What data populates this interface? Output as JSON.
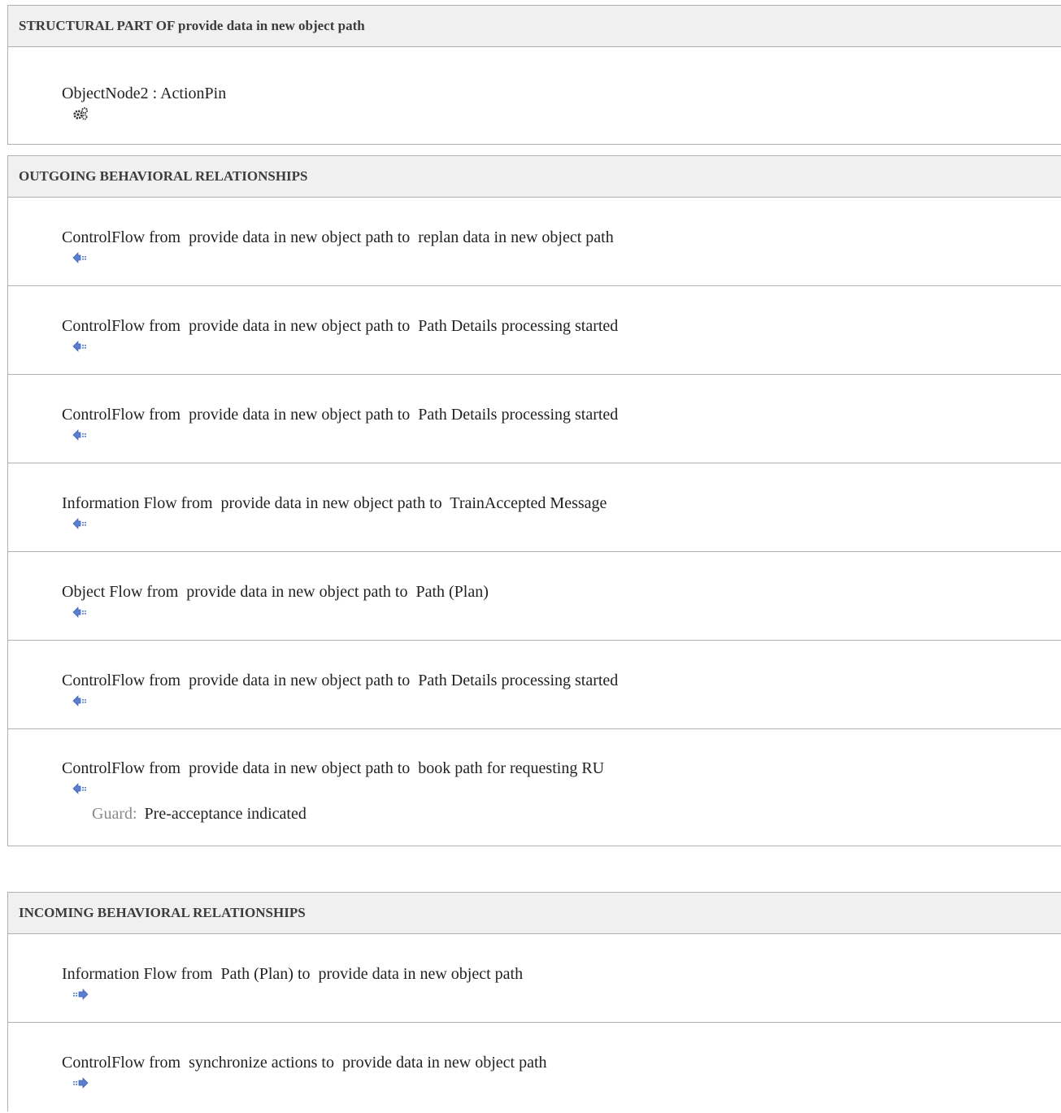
{
  "structural": {
    "header": "STRUCTURAL PART OF provide data in new object path",
    "items": [
      {
        "icon": "gears-icon",
        "text": "ObjectNode2 : ActionPin"
      }
    ]
  },
  "outgoing": {
    "header": "OUTGOING BEHAVIORAL RELATIONSHIPS",
    "items": [
      {
        "icon": "outgoing-arrow-icon",
        "text": "ControlFlow from  provide data in new object path to  replan data in new object path"
      },
      {
        "icon": "outgoing-arrow-icon",
        "text": "ControlFlow from  provide data in new object path to  Path Details processing started"
      },
      {
        "icon": "outgoing-arrow-icon",
        "text": "ControlFlow from  provide data in new object path to  Path Details processing started"
      },
      {
        "icon": "outgoing-arrow-icon",
        "text": "Information Flow from  provide data in new object path to  TrainAccepted Message"
      },
      {
        "icon": "outgoing-arrow-icon",
        "text": "Object Flow from  provide data in new object path to  Path (Plan)"
      },
      {
        "icon": "outgoing-arrow-icon",
        "text": "ControlFlow from  provide data in new object path to  Path Details processing started"
      },
      {
        "icon": "outgoing-arrow-icon",
        "text": "ControlFlow from  provide data in new object path to  book path for requesting RU",
        "guard_label": "Guard:",
        "guard_value": "Pre-acceptance indicated"
      }
    ]
  },
  "incoming": {
    "header": "INCOMING BEHAVIORAL RELATIONSHIPS",
    "items": [
      {
        "icon": "incoming-arrow-icon",
        "text": "Information Flow from  Path (Plan) to  provide data in new object path"
      },
      {
        "icon": "incoming-arrow-icon",
        "text": "ControlFlow from  synchronize actions to  provide data in new object path"
      }
    ]
  },
  "colors": {
    "header_bg": "#f0f0f0",
    "border": "#b0b0b0",
    "guard_label": "#8a8a8a",
    "arrow_blue": "#5a7fd0"
  }
}
